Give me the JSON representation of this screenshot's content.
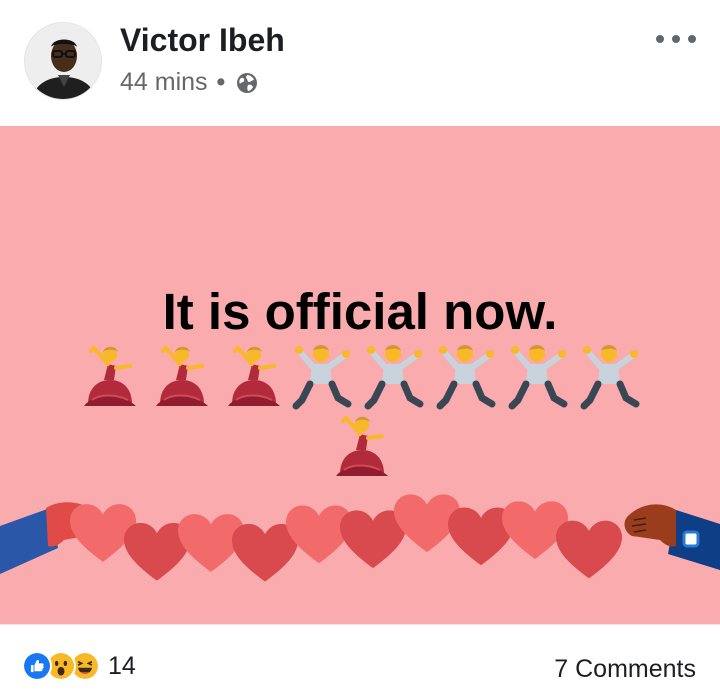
{
  "post": {
    "author": "Victor Ibeh",
    "time": "44 mins",
    "separator": "•",
    "privacy_icon": "globe-icon",
    "more_icon": "more-options-icon"
  },
  "banner": {
    "background_color": "#f9abae",
    "headline": "It is official now.",
    "emoji_row_1": [
      "woman-dancing",
      "woman-dancing",
      "woman-dancing",
      "man-dancing",
      "man-dancing",
      "man-dancing",
      "man-dancing",
      "man-dancing"
    ],
    "emoji_row_2": [
      "woman-dancing"
    ],
    "decoration": "heart-chain-held-by-two-hands"
  },
  "footer": {
    "reaction_icons": [
      "like-icon",
      "wow-icon",
      "haha-icon"
    ],
    "reaction_count": "14",
    "comments": "7 Comments"
  },
  "colors": {
    "heart_light": "#f36a6a",
    "heart_dark": "#d94a4f",
    "like_blue": "#1877f2",
    "emoji_yellow": "#f7b928"
  }
}
